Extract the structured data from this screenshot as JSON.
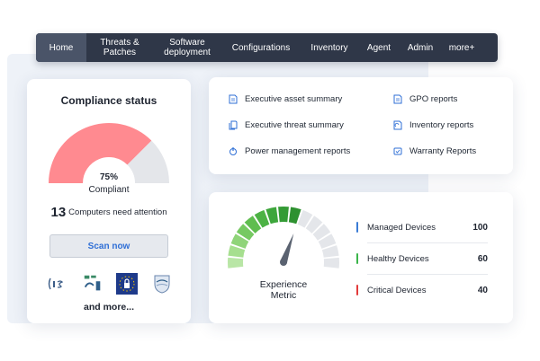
{
  "nav": {
    "items": [
      {
        "label": "Home",
        "active": true
      },
      {
        "label": "Threats &\nPatches"
      },
      {
        "label": "Software\ndeployment"
      },
      {
        "label": "Configurations"
      },
      {
        "label": "Inventory"
      },
      {
        "label": "Agent"
      },
      {
        "label": "Admin"
      },
      {
        "label": "more+"
      }
    ]
  },
  "compliance": {
    "title": "Compliance status",
    "percent": "75%",
    "percent_value": 75,
    "status_label": "Compliant",
    "attention_count": "13",
    "attention_text": "Computers need attention",
    "scan_button": "Scan now",
    "logos": [
      "cis-logo",
      "certification-logo",
      "eu-lock-logo",
      "shield-logo"
    ],
    "more": "and more...",
    "colors": {
      "compliant": "#ff8a90",
      "remaining": "#e4e6ea"
    }
  },
  "reports": {
    "items": [
      {
        "label": "Executive asset summary",
        "icon": "document-icon"
      },
      {
        "label": "GPO reports",
        "icon": "document-icon"
      },
      {
        "label": "Executive threat summary",
        "icon": "documents-icon"
      },
      {
        "label": "Inventory reports",
        "icon": "refresh-document-icon"
      },
      {
        "label": "Power management reports",
        "icon": "power-icon"
      },
      {
        "label": "Warranty Reports",
        "icon": "warranty-icon"
      }
    ]
  },
  "experience": {
    "title_line1": "Experience",
    "title_line2": "Metric",
    "gauge_filled_segments": 9,
    "gauge_total_segments": 15,
    "devices": [
      {
        "label": "Managed Devices",
        "value": "100",
        "color": "#3a7bd5"
      },
      {
        "label": "Healthy Devices",
        "value": "60",
        "color": "#3bb54a"
      },
      {
        "label": "Critical Devices",
        "value": "40",
        "color": "#e23b3b"
      }
    ]
  }
}
